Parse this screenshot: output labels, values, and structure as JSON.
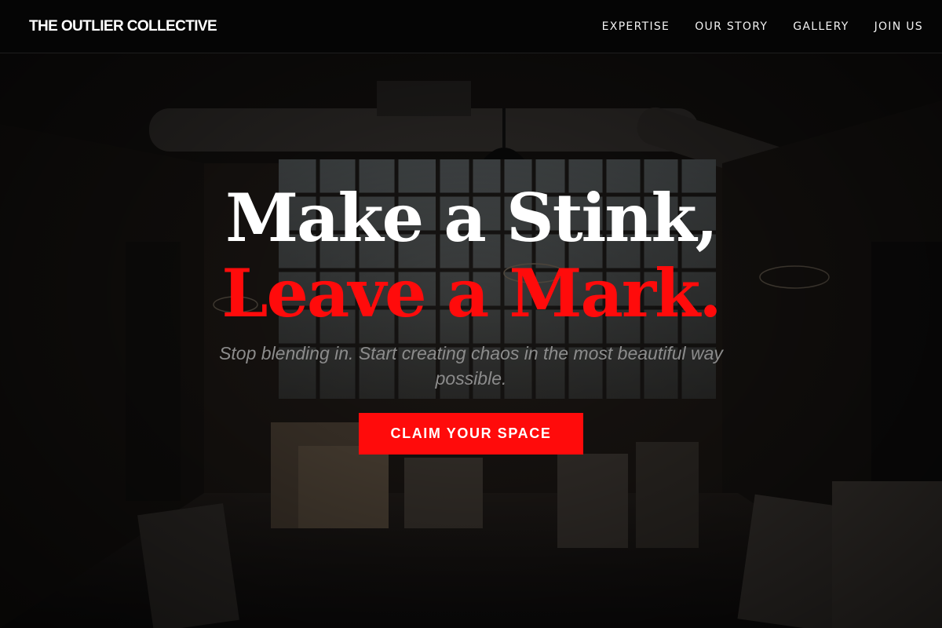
{
  "nav": {
    "logo": "THE OUTLIER COLLECTIVE",
    "links": [
      {
        "label": "EXPERTISE"
      },
      {
        "label": "OUR STORY"
      },
      {
        "label": "GALLERY"
      },
      {
        "label": "JOIN US"
      }
    ]
  },
  "hero": {
    "headline_line1": "Make a Stink,",
    "headline_line2": "Leave a Mark.",
    "subtitle": "Stop blending in. Start creating chaos in the most beautiful way possible.",
    "cta_label": "CLAIM YOUR SPACE",
    "background_image": "dark art studio warehouse interior with canvases and chandeliers"
  },
  "colors": {
    "accent": "#ff0b0b",
    "nav_bg": "#050505",
    "headline": "#ffffff",
    "subtitle": "#8c8c8c"
  }
}
